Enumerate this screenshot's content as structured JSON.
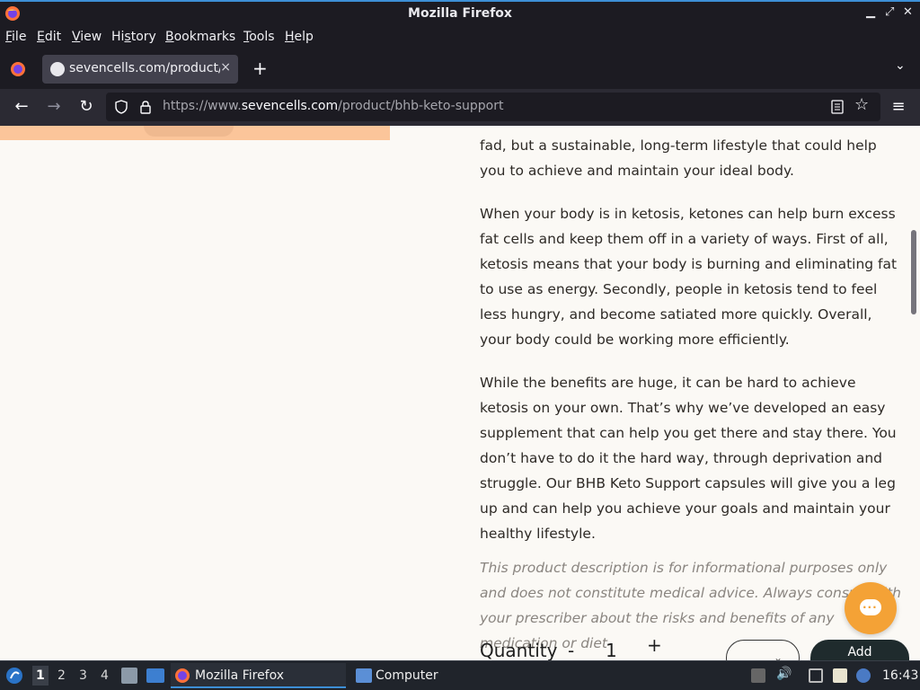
{
  "window": {
    "title": "Mozilla Firefox"
  },
  "menu": [
    "File",
    "Edit",
    "View",
    "History",
    "Bookmarks",
    "Tools",
    "Help"
  ],
  "menu_access_keys": [
    "F",
    "E",
    "V",
    "s",
    "B",
    "T",
    "H"
  ],
  "tab": {
    "label": "sevencells.com/product/b",
    "close": "×"
  },
  "newtab": "+",
  "url": {
    "prefix": "https://www.",
    "domain": "sevencells.com",
    "path": "/product/bhb-keto-support"
  },
  "content": {
    "para0": "fad, but a sustainable, long-term lifestyle that could help you to achieve and maintain your ideal body.",
    "para1": "When your body is in ketosis, ketones can help burn excess fat cells and keep them off in a variety of ways. First of all, ketosis means that your body is burning and eliminating fat to use as energy. Secondly, people in ketosis tend to feel less hungry, and become satiated more quickly. Overall, your body could be working more efficiently.",
    "para2": "While the benefits are huge, it can be hard to achieve ketosis on your own. That’s why we’ve developed an easy supplement that can help you get there and stay there. You don’t have to do it the hard way, through deprivation and struggle. Our BHB Keto Support capsules will give you a leg up and can help you achieve your goals and maintain your healthy lifestyle.",
    "disclaimer": "This product description is for informational purposes only and does not constitute medical advice. Always consult with your prescriber about the risks and benefits of any medication or diet"
  },
  "purchase": {
    "quantity_label": "Quantity",
    "minus": "-",
    "quantity_value": "1",
    "plus": "+",
    "add_label": "Add"
  },
  "taskbar": {
    "workspaces": [
      "1",
      "2",
      "3",
      "4"
    ],
    "tasks": [
      "Mozilla Firefox",
      "Computer"
    ],
    "clock": "16:43"
  },
  "colors": {
    "accent": "#3d8fd6",
    "chat": "#f4a236",
    "peach": "#fbc59a"
  }
}
